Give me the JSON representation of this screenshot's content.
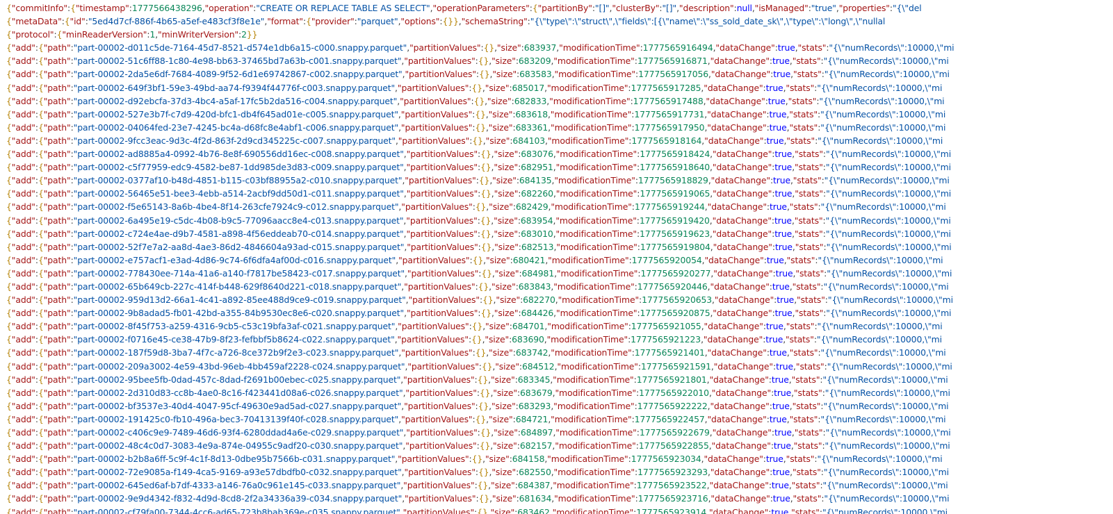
{
  "document": {
    "commit_info": {
      "timestamp": "1777566438296",
      "operation": "\"CREATE OR REPLACE TABLE AS SELECT\"",
      "partition_by": "\"[]\"",
      "cluster_by": "\"[]\"",
      "description": "null",
      "is_managed": "\"true\"",
      "properties_prefix": "\"{\\\"del"
    },
    "metadata": {
      "id": "\"5ed4d7cf-886f-4b65-a5ef-e483cf3f8e1e\"",
      "provider": "\"parquet\"",
      "options": "{}",
      "schema_prefix": "\"{\\\"type\\\":\\\"struct\\\",\\\"fields\\\":[{\\\"name\\\":\\\"ss_sold_date_sk\\\",\\\"type\\\":\\\"long\\\",\\\"nullal"
    },
    "protocol": {
      "min_reader_version": "1",
      "min_writer_version": "2"
    },
    "stats_prefix": "\"{\\\"numRecords\\\":10000,\\\"mi",
    "add_entries": [
      {
        "path": "\"part-00002-d011c5de-7164-45d7-8521-d574e1db6a15-c000.snappy.parquet\"",
        "size": "683937",
        "modification_time": "1777565916494"
      },
      {
        "path": "\"part-00002-51c6ff88-1c80-4e98-bb63-37465bd7a63b-c001.snappy.parquet\"",
        "size": "683209",
        "modification_time": "1777565916871"
      },
      {
        "path": "\"part-00002-2da5e6df-7684-4089-9f52-6d1e69742867-c002.snappy.parquet\"",
        "size": "683583",
        "modification_time": "1777565917056"
      },
      {
        "path": "\"part-00002-649f3bf1-59e3-49bd-aa74-f9394f44776f-c003.snappy.parquet\"",
        "size": "685017",
        "modification_time": "1777565917285"
      },
      {
        "path": "\"part-00002-d92ebcfa-37d3-4bc4-a5af-17fc5b2da516-c004.snappy.parquet\"",
        "size": "682833",
        "modification_time": "1777565917488"
      },
      {
        "path": "\"part-00002-527e3b7f-c7d9-420d-bfc1-db4f645ad01e-c005.snappy.parquet\"",
        "size": "683618",
        "modification_time": "1777565917731"
      },
      {
        "path": "\"part-00002-04064fed-23e7-4245-bc4a-d68fc8e4abf1-c006.snappy.parquet\"",
        "size": "683361",
        "modification_time": "1777565917950"
      },
      {
        "path": "\"part-00002-9fcc3eac-9d3c-4f2d-863f-2d9cd345225c-c007.snappy.parquet\"",
        "size": "684103",
        "modification_time": "1777565918164"
      },
      {
        "path": "\"part-00002-ad8885a4-0992-4b76-8e8f-690556dd16ec-c008.snappy.parquet\"",
        "size": "683076",
        "modification_time": "1777565918424"
      },
      {
        "path": "\"part-00002-c5f77959-edc9-4582-be87-1dd985de3d83-c009.snappy.parquet\"",
        "size": "682951",
        "modification_time": "1777565918640"
      },
      {
        "path": "\"part-00002-0377af10-b48d-4851-b115-c03bf88955a2-c010.snappy.parquet\"",
        "size": "684135",
        "modification_time": "1777565918829"
      },
      {
        "path": "\"part-00002-56465e51-bee3-4ebb-a514-2acbf9dd50d1-c011.snappy.parquet\"",
        "size": "682260",
        "modification_time": "1777565919065"
      },
      {
        "path": "\"part-00002-f5e65143-8a6b-4be4-8f14-263cfe7924c9-c012.snappy.parquet\"",
        "size": "682429",
        "modification_time": "1777565919244"
      },
      {
        "path": "\"part-00002-6a495e19-c5dc-4b08-b9c5-77096aacc8e4-c013.snappy.parquet\"",
        "size": "683954",
        "modification_time": "1777565919420"
      },
      {
        "path": "\"part-00002-c724e4ae-d9b7-4581-a898-4f56eddeab70-c014.snappy.parquet\"",
        "size": "683010",
        "modification_time": "1777565919623"
      },
      {
        "path": "\"part-00002-52f7e7a2-aa8d-4ae3-86d2-4846604a93ad-c015.snappy.parquet\"",
        "size": "682513",
        "modification_time": "1777565919804"
      },
      {
        "path": "\"part-00002-e757acf1-e3ad-4d86-9c74-6f6dfa4af00d-c016.snappy.parquet\"",
        "size": "680421",
        "modification_time": "1777565920054"
      },
      {
        "path": "\"part-00002-778430ee-714a-41a6-a140-f7817be58423-c017.snappy.parquet\"",
        "size": "684981",
        "modification_time": "1777565920277"
      },
      {
        "path": "\"part-00002-65b649cb-227c-414f-b448-629f8640d221-c018.snappy.parquet\"",
        "size": "683843",
        "modification_time": "1777565920446"
      },
      {
        "path": "\"part-00002-959d13d2-66a1-4c41-a892-85ee488d9ce9-c019.snappy.parquet\"",
        "size": "682270",
        "modification_time": "1777565920653"
      },
      {
        "path": "\"part-00002-9b8adad5-fb01-42bd-a355-84b9530ec8e6-c020.snappy.parquet\"",
        "size": "684426",
        "modification_time": "1777565920875"
      },
      {
        "path": "\"part-00002-8f45f753-a259-4316-9cb5-c53c19bfa3af-c021.snappy.parquet\"",
        "size": "684701",
        "modification_time": "1777565921055"
      },
      {
        "path": "\"part-00002-f0716e45-ce38-47b9-8f23-fefbbf5b8624-c022.snappy.parquet\"",
        "size": "683690",
        "modification_time": "1777565921223"
      },
      {
        "path": "\"part-00002-187f59d8-3ba7-4f7c-a726-8ce372b9f2e3-c023.snappy.parquet\"",
        "size": "683742",
        "modification_time": "1777565921401"
      },
      {
        "path": "\"part-00002-209a3002-4e59-43bd-96eb-4bb459af2228-c024.snappy.parquet\"",
        "size": "684512",
        "modification_time": "1777565921591"
      },
      {
        "path": "\"part-00002-95bee5fb-0dad-457c-8dad-f2691b00ebec-c025.snappy.parquet\"",
        "size": "683345",
        "modification_time": "1777565921801"
      },
      {
        "path": "\"part-00002-2d310d83-cc8b-4ae0-8c16-f423441d08a6-c026.snappy.parquet\"",
        "size": "683679",
        "modification_time": "1777565922010"
      },
      {
        "path": "\"part-00002-bf3537e3-40d4-4047-95cf-49630e9ad5ad-c027.snappy.parquet\"",
        "size": "683293",
        "modification_time": "1777565922222"
      },
      {
        "path": "\"part-00002-191425c0-fb10-496a-bec3-70413139f40f-c028.snappy.parquet\"",
        "size": "684721",
        "modification_time": "1777565922457"
      },
      {
        "path": "\"part-00002-c406c9e9-7489-46d6-93f4-6280ddad4a6e-c029.snappy.parquet\"",
        "size": "684897",
        "modification_time": "1777565922679"
      },
      {
        "path": "\"part-00002-48c4c0d7-3083-4e9a-874e-04955c9adf20-c030.snappy.parquet\"",
        "size": "682157",
        "modification_time": "1777565922855"
      },
      {
        "path": "\"part-00002-b2b8a6ff-5c9f-4c1f-8d13-0dbe95b7566b-c031.snappy.parquet\"",
        "size": "684158",
        "modification_time": "1777565923034"
      },
      {
        "path": "\"part-00002-72e9085a-f149-4ca5-9169-a93e57dbdfb0-c032.snappy.parquet\"",
        "size": "682550",
        "modification_time": "1777565923293"
      },
      {
        "path": "\"part-00002-645ed6af-b7df-4333-a146-76a0c961e145-c033.snappy.parquet\"",
        "size": "684387",
        "modification_time": "1777565923522"
      },
      {
        "path": "\"part-00002-9e9d4342-f832-4d9d-8cd8-2f2a34336a39-c034.snappy.parquet\"",
        "size": "681634",
        "modification_time": "1777565923716"
      },
      {
        "path": "\"part-00002-cf79fa00-7344-4cc6-ad65-723b8bab369e-c035.snappy.parquet\"",
        "size": "683462",
        "modification_time": "1777565923914"
      }
    ]
  },
  "colors": {
    "background": "#ffffff",
    "punctuation": "#3b3b3b",
    "brace": "#b8860b",
    "key": "#a31515",
    "string": "#0451a5",
    "number": "#098658",
    "literal": "#0000ff"
  }
}
